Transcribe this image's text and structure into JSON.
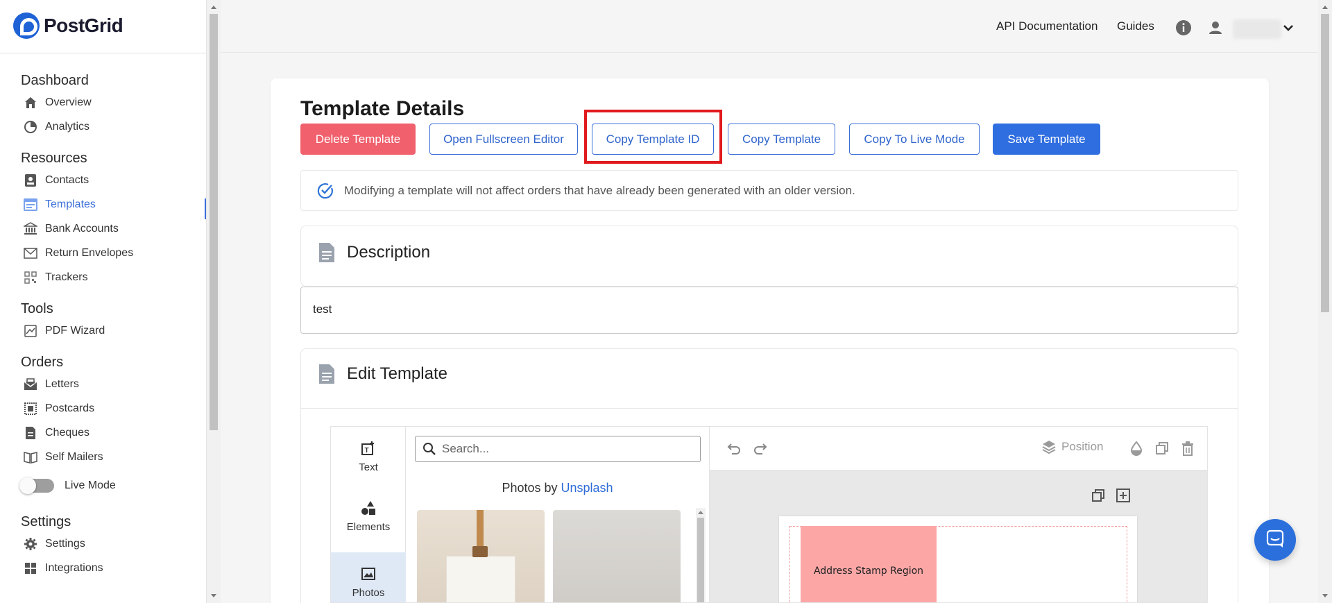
{
  "brand": {
    "name": "PostGrid"
  },
  "sidebar": {
    "sections": [
      {
        "title": "Dashboard",
        "items": [
          {
            "label": "Overview",
            "icon": "home-icon"
          },
          {
            "label": "Analytics",
            "icon": "pie-chart-icon"
          }
        ]
      },
      {
        "title": "Resources",
        "items": [
          {
            "label": "Contacts",
            "icon": "contact-card-icon"
          },
          {
            "label": "Templates",
            "icon": "template-icon",
            "active": true
          },
          {
            "label": "Bank Accounts",
            "icon": "bank-icon"
          },
          {
            "label": "Return Envelopes",
            "icon": "envelope-icon"
          },
          {
            "label": "Trackers",
            "icon": "qr-code-icon"
          }
        ]
      },
      {
        "title": "Tools",
        "items": [
          {
            "label": "PDF Wizard",
            "icon": "pdf-wizard-icon"
          }
        ]
      },
      {
        "title": "Orders",
        "items": [
          {
            "label": "Letters",
            "icon": "letter-icon"
          },
          {
            "label": "Postcards",
            "icon": "postcard-icon"
          },
          {
            "label": "Cheques",
            "icon": "cheque-icon"
          },
          {
            "label": "Self Mailers",
            "icon": "self-mailer-icon"
          }
        ]
      }
    ],
    "live_mode_label": "Live Mode",
    "live_mode_on": false,
    "settings_section": {
      "title": "Settings",
      "items": [
        {
          "label": "Settings",
          "icon": "gear-icon"
        },
        {
          "label": "Integrations",
          "icon": "grid-icon"
        }
      ]
    }
  },
  "topbar": {
    "api_docs": "API Documentation",
    "guides": "Guides"
  },
  "page": {
    "title": "Template Details",
    "buttons": {
      "delete": "Delete Template",
      "fullscreen": "Open Fullscreen Editor",
      "copy_id": "Copy Template ID",
      "copy_template": "Copy Template",
      "copy_live": "Copy To Live Mode",
      "save": "Save Template"
    },
    "info_message": "Modifying a template will not affect orders that have already been generated with an older version.",
    "description": {
      "heading": "Description",
      "value": "test"
    },
    "edit": {
      "heading": "Edit Template"
    }
  },
  "editor": {
    "tabs": [
      {
        "label": "Text",
        "icon": "text-add-icon"
      },
      {
        "label": "Elements",
        "icon": "shapes-icon"
      },
      {
        "label": "Photos",
        "icon": "image-icon",
        "active": true
      }
    ],
    "search_placeholder": "Search...",
    "photos_by_prefix": "Photos by",
    "photos_by_link": "Unsplash",
    "toolbar": {
      "position_label": "Position"
    },
    "canvas": {
      "stamp_region_label": "Address Stamp Region"
    }
  },
  "colors": {
    "primary": "#2f6ee0",
    "danger": "#f0606d",
    "highlight": "#e0191d",
    "stamp_region": "#fca6a6"
  }
}
